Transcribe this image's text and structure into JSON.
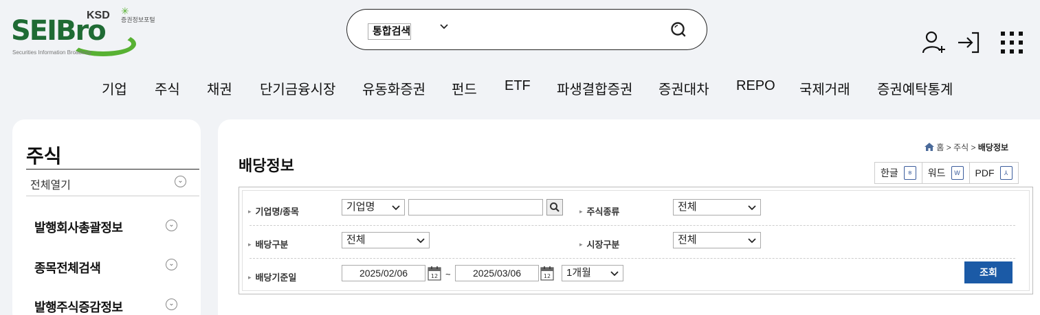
{
  "logo": {
    "brand": "SEIBro",
    "ksd": "KSD",
    "ksd_korean": "증권정보포털",
    "subtitle": "Securities Information Broadway"
  },
  "search": {
    "category": "통합검색",
    "placeholder": "",
    "value": ""
  },
  "header_icons": [
    "user-add-icon",
    "login-icon",
    "apps-grid-icon"
  ],
  "gnb": [
    "기업",
    "주식",
    "채권",
    "단기금융시장",
    "유동화증권",
    "펀드",
    "ETF",
    "파생결합증권",
    "증권대차",
    "REPO",
    "국제거래",
    "증권예탁통계"
  ],
  "sidebar": {
    "title": "주식",
    "open_all": "전체열기",
    "items": [
      "발행회사총괄정보",
      "종목전체검색",
      "발행주식증감정보"
    ]
  },
  "breadcrumb": {
    "home": "홈",
    "level1": "주식",
    "current": "배당정보",
    "sep": ">"
  },
  "page_title": "배당정보",
  "doc_buttons": [
    "한글",
    "워드",
    "PDF"
  ],
  "filters": {
    "company_label": "기업명/종목",
    "company_select": "기업명",
    "company_input": "",
    "stock_type_label": "주식종류",
    "stock_type_value": "전체",
    "dividend_type_label": "배당구분",
    "dividend_type_value": "전체",
    "market_label": "시장구분",
    "market_value": "전체",
    "base_date_label": "배당기준일",
    "date_from": "2025/02/06",
    "date_to": "2025/03/06",
    "tilde": "~",
    "period_value": "1개월",
    "search_button": "조회"
  },
  "colors": {
    "brand_green": "#1f6b34",
    "accent_blue": "#1b5aa6",
    "background": "#f1f3f6"
  }
}
